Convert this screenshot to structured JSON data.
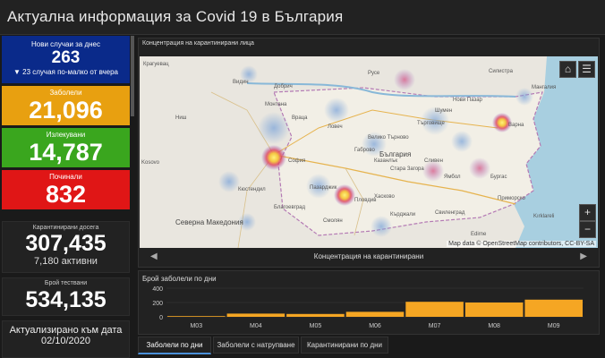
{
  "header": {
    "title": "Актуална информация за Covid 19 в България"
  },
  "cards": {
    "new_cases": {
      "label": "Нови случаи за днес",
      "value": "263",
      "sub": "▼ 23 случая по-малко от вчера"
    },
    "infected": {
      "label": "Заболели",
      "value": "21,096"
    },
    "recovered": {
      "label": "Излекувани",
      "value": "14,787"
    },
    "deceased": {
      "label": "Починали",
      "value": "832"
    },
    "quarantined": {
      "label": "Карантинирани досега",
      "value": "307,435",
      "sub": "7,180 активни"
    },
    "tests": {
      "label": "Брой тествани",
      "value": "534,135"
    },
    "updated": {
      "label": "Актуализирано към дата",
      "date": "02/10/2020"
    }
  },
  "map_panel": {
    "title": "Концентрация на карантинирани лица",
    "caption": "Концентрация на карантинирани",
    "attribution": "Map data © OpenStreetMap contributors, CC-BY-SA",
    "labels": [
      "Крагуевац",
      "Видин",
      "Плевен",
      "Русе",
      "Силистра",
      "Велико Търново",
      "Шумен",
      "Варна",
      "Мангалия",
      "Търговище",
      "Добрич",
      "Ловеч",
      "София",
      "Пловдив",
      "Стара Загора",
      "Сливен",
      "Бургас",
      "Ямбол",
      "Кърджали",
      "Хасково",
      "Смолян",
      "Благоевград",
      "Пазарджик",
      "Кюстендил",
      "Kosovo",
      "Северна Македония",
      "Kırklareli",
      "Edirne",
      "Ниш",
      "България",
      "Монтана",
      "Враца",
      "Габрово",
      "Казанлък",
      "Свиленград",
      "Приморско",
      "Нови Пазар",
      "Силистра"
    ],
    "buttons": {
      "home": "⌂",
      "list": "☰",
      "zoom_in": "+",
      "zoom_out": "−"
    }
  },
  "chart_panel": {
    "title": "Брой заболели по дни",
    "y_ticks": [
      "400",
      "200",
      "0"
    ],
    "x_ticks": [
      "M03",
      "M04",
      "M05",
      "M06",
      "M07",
      "M08",
      "M09"
    ]
  },
  "chart_data": {
    "type": "bar",
    "title": "Брой заболели по дни",
    "x": [
      "M03",
      "M04",
      "M05",
      "M06",
      "M07",
      "M08",
      "M09"
    ],
    "categories": [
      "M03",
      "M04",
      "M05",
      "M06",
      "M07",
      "M08",
      "M09"
    ],
    "values": [
      10,
      45,
      40,
      70,
      210,
      200,
      240
    ],
    "ylim": [
      0,
      400
    ]
  },
  "tabs": [
    "Заболели по дни",
    "Заболели с натрупване",
    "Карантинирани по дни"
  ],
  "colors": {
    "new": "#0a2a8a",
    "infected": "#e8a010",
    "recovered": "#3aa61e",
    "deceased": "#e01616",
    "bars": "#f5a623"
  }
}
